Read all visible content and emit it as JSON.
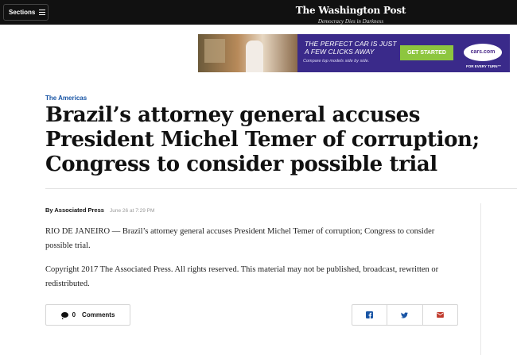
{
  "topbar": {
    "sections_label": "Sections",
    "logo": "The Washington Post",
    "tagline": "Democracy Dies in Darkness"
  },
  "ad": {
    "headline_line1": "THE PERFECT CAR IS JUST",
    "headline_line2": "A FEW CLICKS AWAY",
    "subline": "Compare top models side by side.",
    "cta": "GET STARTED",
    "brand": "cars.com",
    "brand_tagline": "FOR EVERY TURN™",
    "colors": {
      "background": "#3a2a8a",
      "cta": "#8dc63f"
    }
  },
  "article": {
    "section": "The Americas",
    "headline": "Brazil’s attorney general accuses President Michel Temer of corruption; Congress to consider possible trial",
    "byline": "By Associated Press",
    "timestamp": "June 26 at 7:29 PM",
    "paragraphs": [
      "RIO DE JANEIRO — Brazil’s attorney general accuses President Michel Temer of corruption; Congress to consider possible trial.",
      "Copyright 2017 The Associated Press. All rights reserved. This material may not be published, broadcast, rewritten or redistributed."
    ]
  },
  "footer": {
    "comment_count": "0",
    "comments_label": "Comments",
    "share_icons": [
      "facebook-icon",
      "twitter-icon",
      "email-icon"
    ],
    "colors": {
      "share_icon": "#1955a5",
      "email_icon": "#c0392b"
    }
  }
}
